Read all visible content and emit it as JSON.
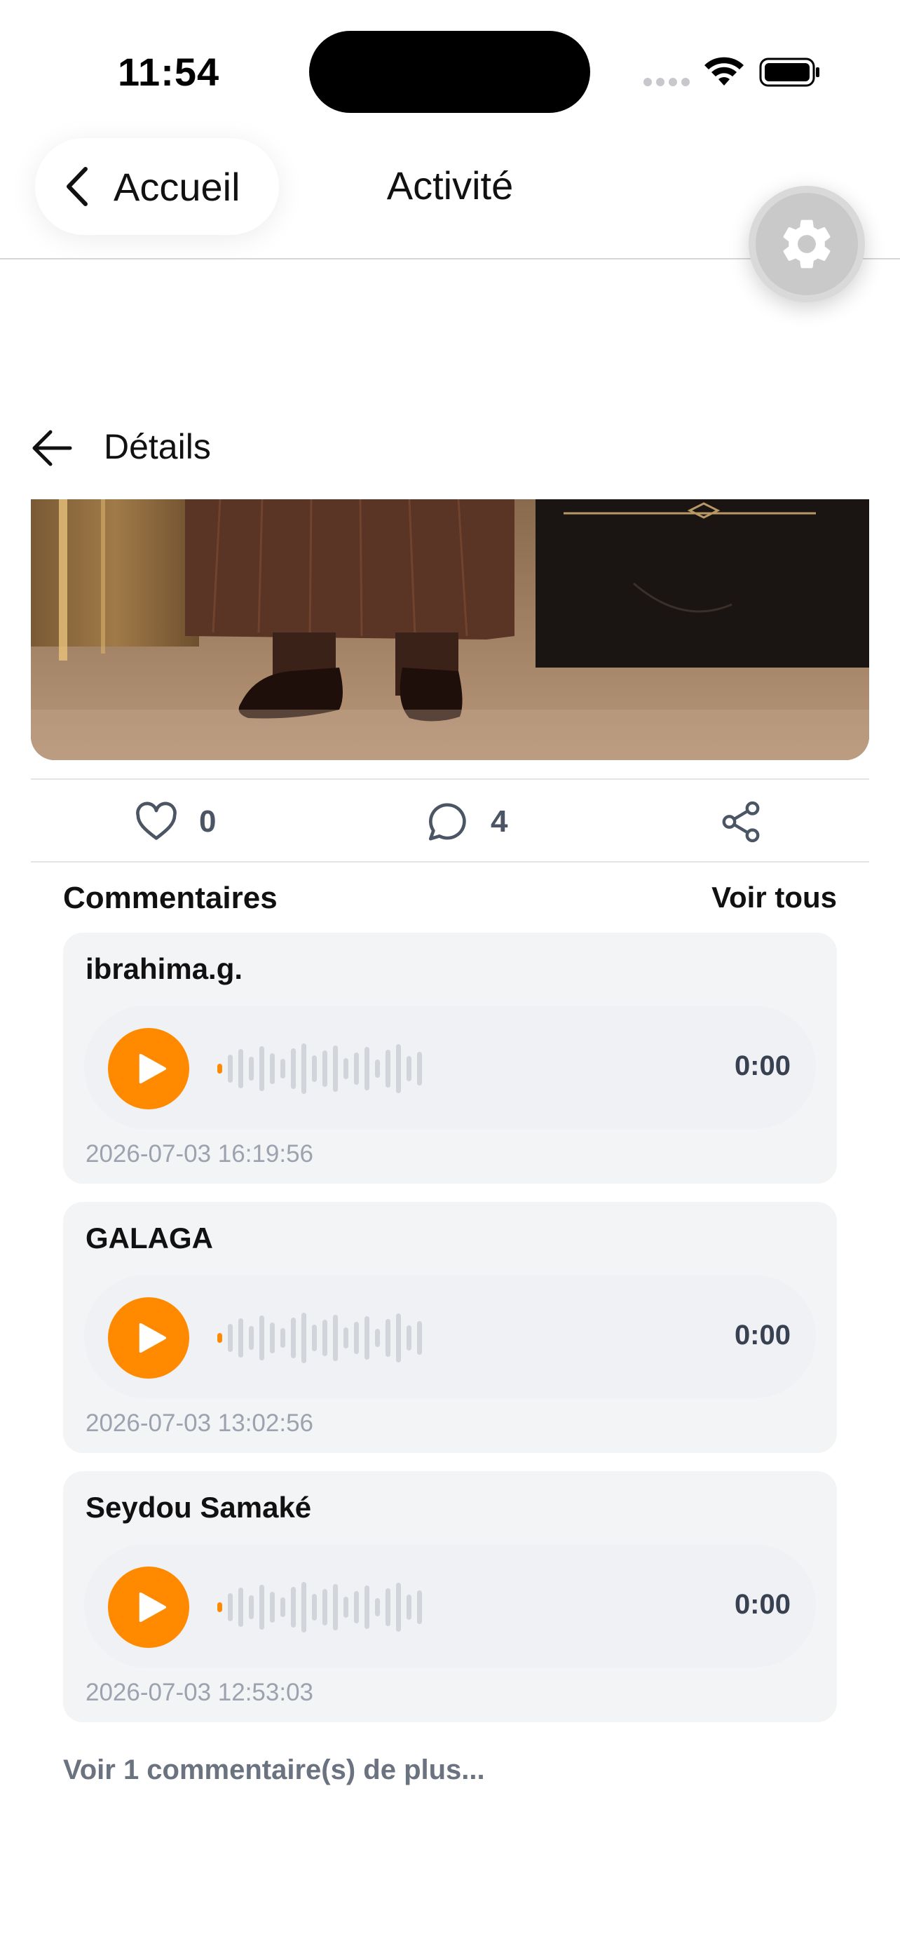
{
  "status_bar": {
    "time": "11:54"
  },
  "nav": {
    "back_label": "Accueil",
    "title": "Activité"
  },
  "details": {
    "title": "Détails"
  },
  "actions": {
    "likes": "0",
    "comments": "4"
  },
  "comments_section": {
    "title": "Commentaires",
    "see_all": "Voir tous",
    "items": [
      {
        "author": "ibrahima.g.",
        "duration": "0:00",
        "date": "2026-07-03 16:19:56"
      },
      {
        "author": "GALAGA",
        "duration": "0:00",
        "date": "2026-07-03 13:02:56"
      },
      {
        "author": "Seydou Samaké",
        "duration": "0:00",
        "date": "2026-07-03 12:53:03"
      }
    ],
    "more_link": "Voir 1 commentaire(s) de plus..."
  },
  "colors": {
    "accent": "#ff8a00",
    "card_bg": "#f3f4f6",
    "muted_text": "#9ca3af"
  }
}
